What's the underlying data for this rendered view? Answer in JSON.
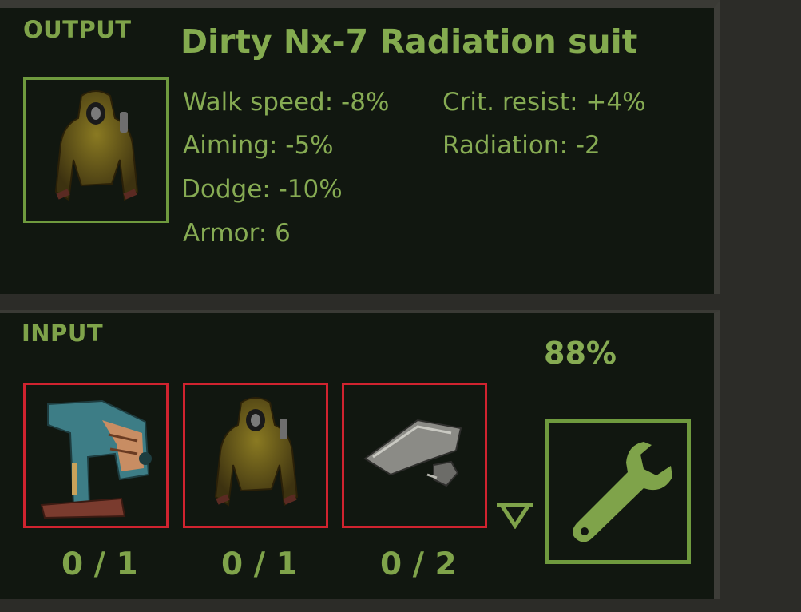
{
  "output": {
    "section_label": "OUTPUT",
    "item_name": "Dirty Nx-7 Radiation suit",
    "item_icon": "radiation-suit-icon",
    "stats_left": [
      "Walk speed: -8%",
      "Aiming: -5%",
      "Dodge: -10%",
      "Armor: 6"
    ],
    "stats_right": [
      "Crit. resist: +4%",
      "Radiation: -2"
    ]
  },
  "input": {
    "section_label": "INPUT",
    "progress": "88%",
    "progress_value": 0.88,
    "slots": [
      {
        "icon": "sewing-machine-icon",
        "count": "0 / 1"
      },
      {
        "icon": "radiation-suit-icon",
        "count": "0 / 1"
      },
      {
        "icon": "metal-scrap-icon",
        "count": "0 / 2"
      }
    ],
    "craft_icon": "wrench-icon"
  },
  "colors": {
    "accent_green": "#7fa34a",
    "missing_red": "#d0232f",
    "panel_bg": "#111710"
  }
}
